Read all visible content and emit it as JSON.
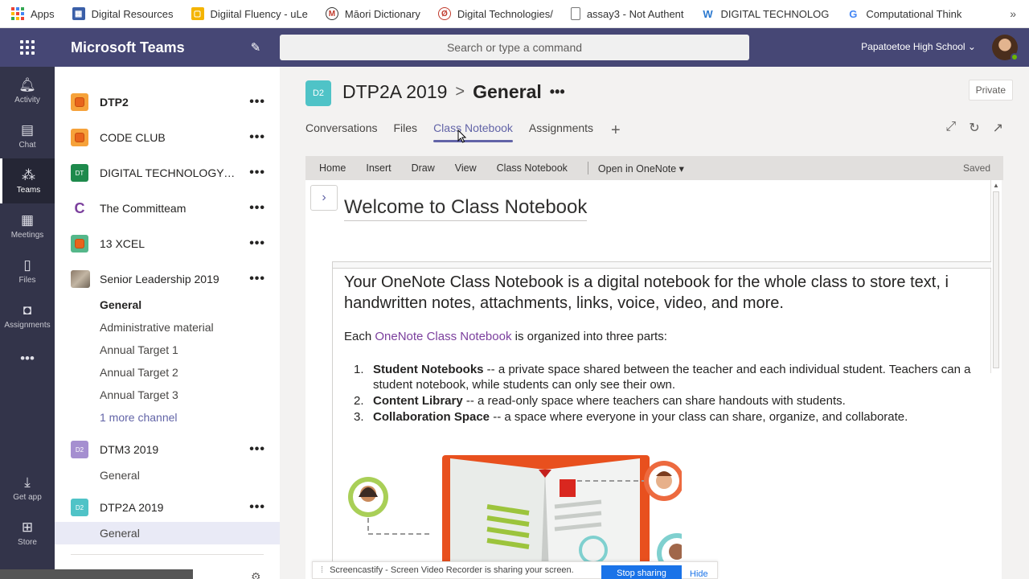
{
  "bookmarks": [
    {
      "label": "Apps",
      "icon": "apps-grid-icon",
      "color": "#4285f4"
    },
    {
      "label": "Digital Resources",
      "icon": "bookmark-blue-icon",
      "color": "#3a5fa8"
    },
    {
      "label": "Digiital Fluency - uLe",
      "icon": "bookmark-yellow-icon",
      "color": "#f4b400"
    },
    {
      "label": "Māori Dictionary",
      "icon": "maori-dictionary-icon",
      "color": "#c0392b"
    },
    {
      "label": "Digital Technologies/",
      "icon": "digital-tech-icon",
      "color": "#c0392b"
    },
    {
      "label": "assay3 - Not Authent",
      "icon": "document-icon",
      "color": "#888888"
    },
    {
      "label": "DIGITAL TECHNOLOG",
      "icon": "w-icon",
      "color": "#2b79d0"
    },
    {
      "label": "Computational Think",
      "icon": "google-icon",
      "color": "#4285f4"
    }
  ],
  "bookmarks_more": "»",
  "topbar": {
    "title": "Microsoft Teams",
    "search_placeholder": "Search or type a command",
    "org": "Papatoetoe High School ⌄"
  },
  "rail": [
    {
      "label": "Activity",
      "glyph": "🔔"
    },
    {
      "label": "Chat",
      "glyph": "💬"
    },
    {
      "label": "Teams",
      "glyph": "👥"
    },
    {
      "label": "Meetings",
      "glyph": "📅"
    },
    {
      "label": "Files",
      "glyph": "📄"
    },
    {
      "label": "Assignments",
      "glyph": "🎒"
    },
    {
      "label": "",
      "glyph": "•••"
    },
    {
      "label": "Get app",
      "glyph": "⬇"
    },
    {
      "label": "Store",
      "glyph": "⊞"
    }
  ],
  "teams": {
    "dtp2": "DTP2",
    "codeclub": "CODE CLUB",
    "digitech": "DIGITAL TECHNOLOGY A...",
    "digitech_initials": "DT",
    "committeam": "The Committeam",
    "xcel": "13 XCEL",
    "senior": "Senior Leadership 2019",
    "senior_channels": [
      "General",
      "Administrative material",
      "Annual Target 1",
      "Annual Target 2",
      "Annual Target 3",
      "1 more channel"
    ],
    "dtm3": "DTM3 2019",
    "dtm3_initials": "D2",
    "dtm3_channel": "General",
    "dtp2a": "DTP2A 2019",
    "dtp2a_initials": "D2",
    "dtp2a_channel": "General",
    "more": "•••"
  },
  "header": {
    "tile": "D2",
    "team": "DTP2A 2019",
    "sep": ">",
    "channel": "General",
    "dots": "•••",
    "private": "Private",
    "tabs": [
      "Conversations",
      "Files",
      "Class Notebook",
      "Assignments"
    ],
    "add": "+"
  },
  "ribbon": {
    "items": [
      "Home",
      "Insert",
      "Draw",
      "View",
      "Class Notebook"
    ],
    "open": "Open in OneNote ▾",
    "saved": "Saved"
  },
  "page": {
    "title": "Welcome to Class Notebook",
    "intro_1": "Your OneNote Class Notebook is a digital notebook for the whole class to store text, i",
    "intro_2": "handwritten notes, attachments, links, voice, video, and more.",
    "org_pre": "Each ",
    "org_link": "OneNote Class Notebook",
    "org_post": " is organized into three parts:",
    "parts": [
      {
        "num": "1.",
        "name": "Student Notebooks",
        "text": " -- a private space shared between the teacher and each individual student. Teachers can a",
        "line2": "student notebook, while students can only see their own."
      },
      {
        "num": "2.",
        "name": "Content Library",
        "text": " -- a read-only space where teachers can share handouts with students."
      },
      {
        "num": "3.",
        "name": "Collaboration Space",
        "text": " -- a space where everyone in your class can share, organize, and collaborate."
      }
    ]
  },
  "cast": {
    "text": "Screencastify - Screen Video Recorder is sharing your screen.",
    "stop": "Stop sharing",
    "hide": "Hide"
  },
  "colors": {
    "teams_purple": "#464775",
    "rail": "#33344a",
    "accent": "#6264a7",
    "tile_teal": "#4fc3c7",
    "tile_purple": "#a58fd0"
  }
}
